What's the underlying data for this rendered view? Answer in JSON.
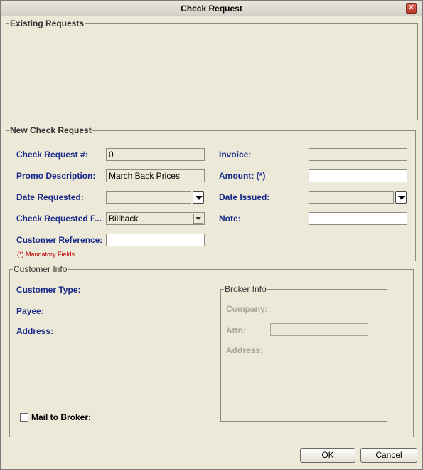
{
  "window": {
    "title": "Check Request",
    "close_symbol": "✕"
  },
  "existing_requests": {
    "title": "Existing Requests"
  },
  "new_request": {
    "title": "New Check Request",
    "check_request_no": {
      "label": "Check Request #:",
      "value": "0"
    },
    "promo_description": {
      "label": "Promo Description:",
      "value": "March Back Prices"
    },
    "date_requested": {
      "label": "Date Requested:",
      "value": ""
    },
    "check_requested_for": {
      "label": "Check Requested F...",
      "value": "Billback"
    },
    "customer_reference": {
      "label": "Customer Reference:",
      "value": ""
    },
    "invoice": {
      "label": "Invoice:",
      "value": ""
    },
    "amount": {
      "label": "Amount: (*)",
      "value": ""
    },
    "date_issued": {
      "label": "Date Issued:",
      "value": ""
    },
    "note": {
      "label": "Note:",
      "value": ""
    },
    "mandatory_note": "(*) Mandatory Fields"
  },
  "customer_info": {
    "title": "Customer Info",
    "customer_type_label": "Customer Type:",
    "payee_label": "Payee:",
    "address_label": "Address:",
    "mail_to_broker_label": "Mail to Broker:",
    "mail_to_broker_checked": false,
    "broker_info": {
      "title": "Broker Info",
      "company_label": "Company:",
      "attn_label": "Attn:",
      "attn_value": "",
      "address_label": "Address:"
    }
  },
  "buttons": {
    "ok": "OK",
    "cancel": "Cancel"
  }
}
